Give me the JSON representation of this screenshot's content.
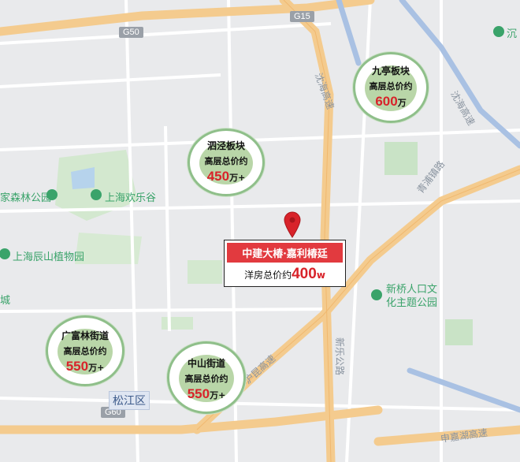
{
  "highways": {
    "g15": "G15",
    "g50": "G50",
    "g60": "G60"
  },
  "roads": {
    "shenhai_1": "沈海高速",
    "shenhai_2": "沈海高速",
    "xinqiao": "新乐公路",
    "hu_expressway": "沪昆高速",
    "qingpu": "青浦镇路",
    "east_road": "申嘉湖高速"
  },
  "pois": {
    "forest_park": "家森林公园",
    "happy_valley": "上海欢乐谷",
    "botanical": "上海辰山植物园",
    "town": "城",
    "culture_park_1": "新桥人口文",
    "culture_park_2": "化主题公园",
    "top_right": "沉"
  },
  "district": "松江区",
  "bubbles": [
    {
      "name": "九亭板块",
      "sub": "高层总价约",
      "price": "600",
      "unit": "万"
    },
    {
      "name": "泗泾板块",
      "sub": "高层总价约",
      "price": "450",
      "unit": "万+"
    },
    {
      "name": "广富林街道",
      "sub": "高层总价约",
      "price": "550",
      "unit": "万+"
    },
    {
      "name": "中山街道",
      "sub": "高层总价约",
      "price": "550",
      "unit": "万+"
    }
  ],
  "project": {
    "name": "中建大椿·嘉利椿廷",
    "price_label": "洋房总价约",
    "price": "400",
    "unit": "w"
  },
  "colors": {
    "marker": "#d8232a",
    "card_header": "#e23a3f",
    "bubble_ring": "#8fbf8a",
    "bubble_fill": "#b9d6a8",
    "highway": "#f3c98a",
    "park": "#c9e3c6"
  }
}
